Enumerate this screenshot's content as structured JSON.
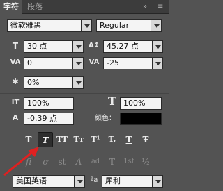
{
  "tabs": [
    {
      "label": "字符"
    },
    {
      "label": "段落"
    }
  ],
  "header_icons": {
    "collapse": "»",
    "menu": "≡"
  },
  "font": {
    "family": "微软雅黑",
    "style": "Regular"
  },
  "size": {
    "icon": "T",
    "value": "30 点"
  },
  "leading": {
    "icon": "A↕",
    "value": "45.27 点"
  },
  "kerning": {
    "icon": "VA",
    "value": "0"
  },
  "tracking": {
    "icon": "VA",
    "value": "-25"
  },
  "tsume": {
    "icon": "✱",
    "value": "0%"
  },
  "vertical_scale": {
    "icon": "IT",
    "value": "100%"
  },
  "horizontal_scale": {
    "icon": "T",
    "value": "100%"
  },
  "baseline": {
    "icon": "A",
    "value": "-0.39 点"
  },
  "color": {
    "label": "颜色：",
    "swatch": "#000000"
  },
  "style_buttons": [
    "T",
    "T",
    "TT",
    "Tт",
    "T¹",
    "T,",
    "T",
    "Ŧ"
  ],
  "opentype_buttons": [
    "fi",
    "ơ",
    "st",
    "A",
    "ad",
    "T",
    "1st",
    "½"
  ],
  "language": {
    "value": "美国英语"
  },
  "antialias": {
    "icon": "ªa",
    "value": "犀利"
  },
  "accent_color": "#e02020"
}
